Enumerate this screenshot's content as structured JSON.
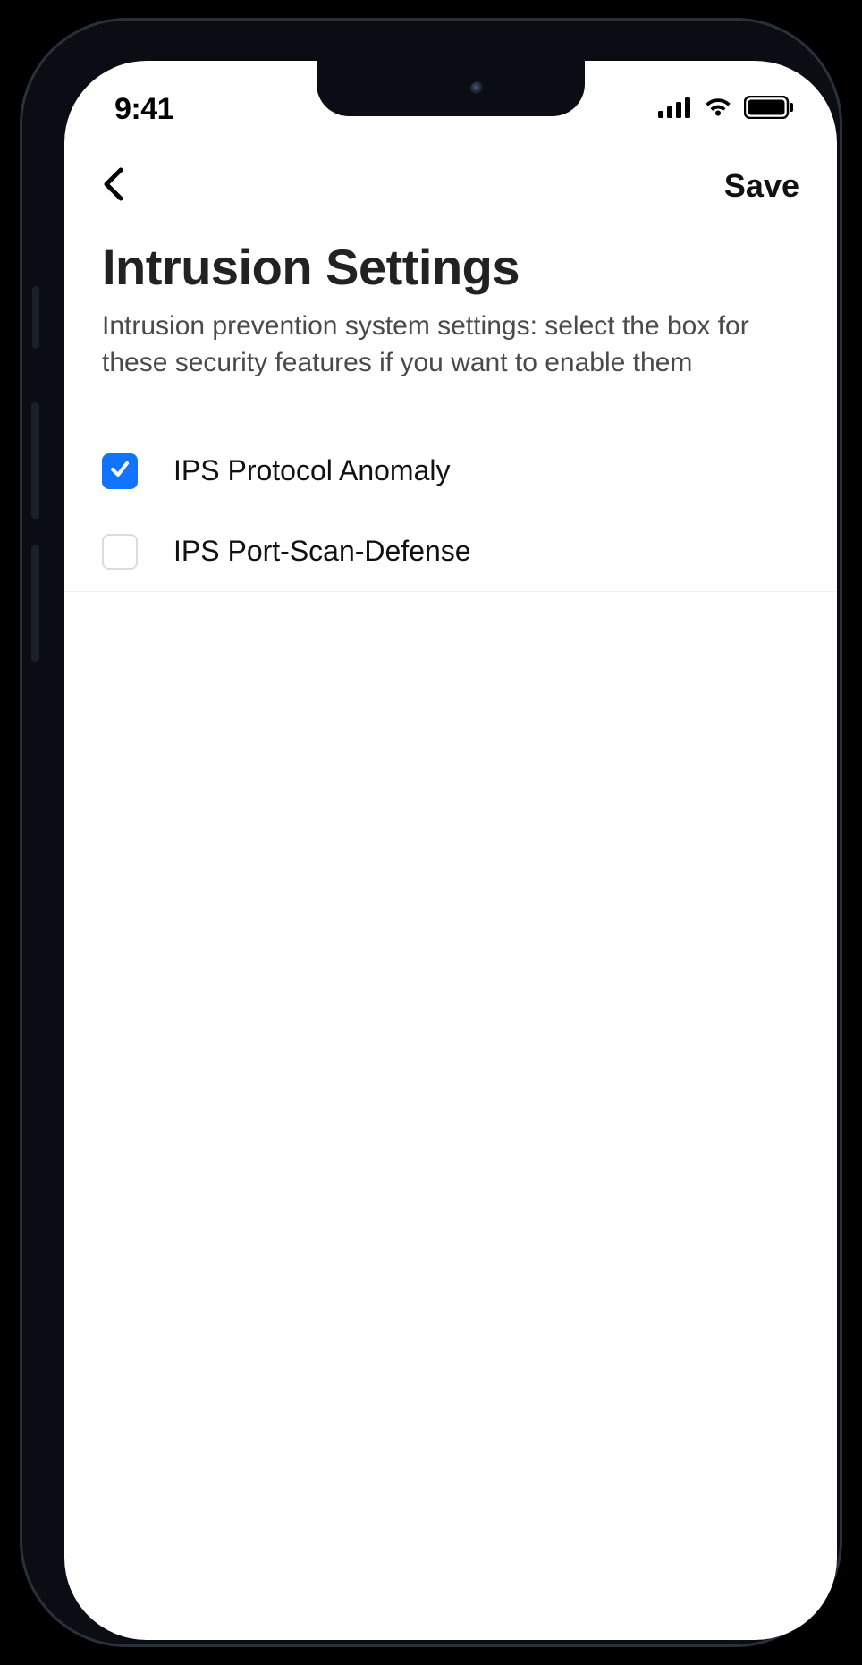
{
  "status": {
    "time": "9:41"
  },
  "nav": {
    "save_label": "Save"
  },
  "header": {
    "title": "Intrusion Settings",
    "description": "Intrusion prevention system settings: select the box for these security features if you want to enable them"
  },
  "options": [
    {
      "label": "IPS Protocol Anomaly",
      "checked": true
    },
    {
      "label": "IPS Port-Scan-Defense",
      "checked": false
    }
  ],
  "colors": {
    "accent": "#1173ff"
  }
}
